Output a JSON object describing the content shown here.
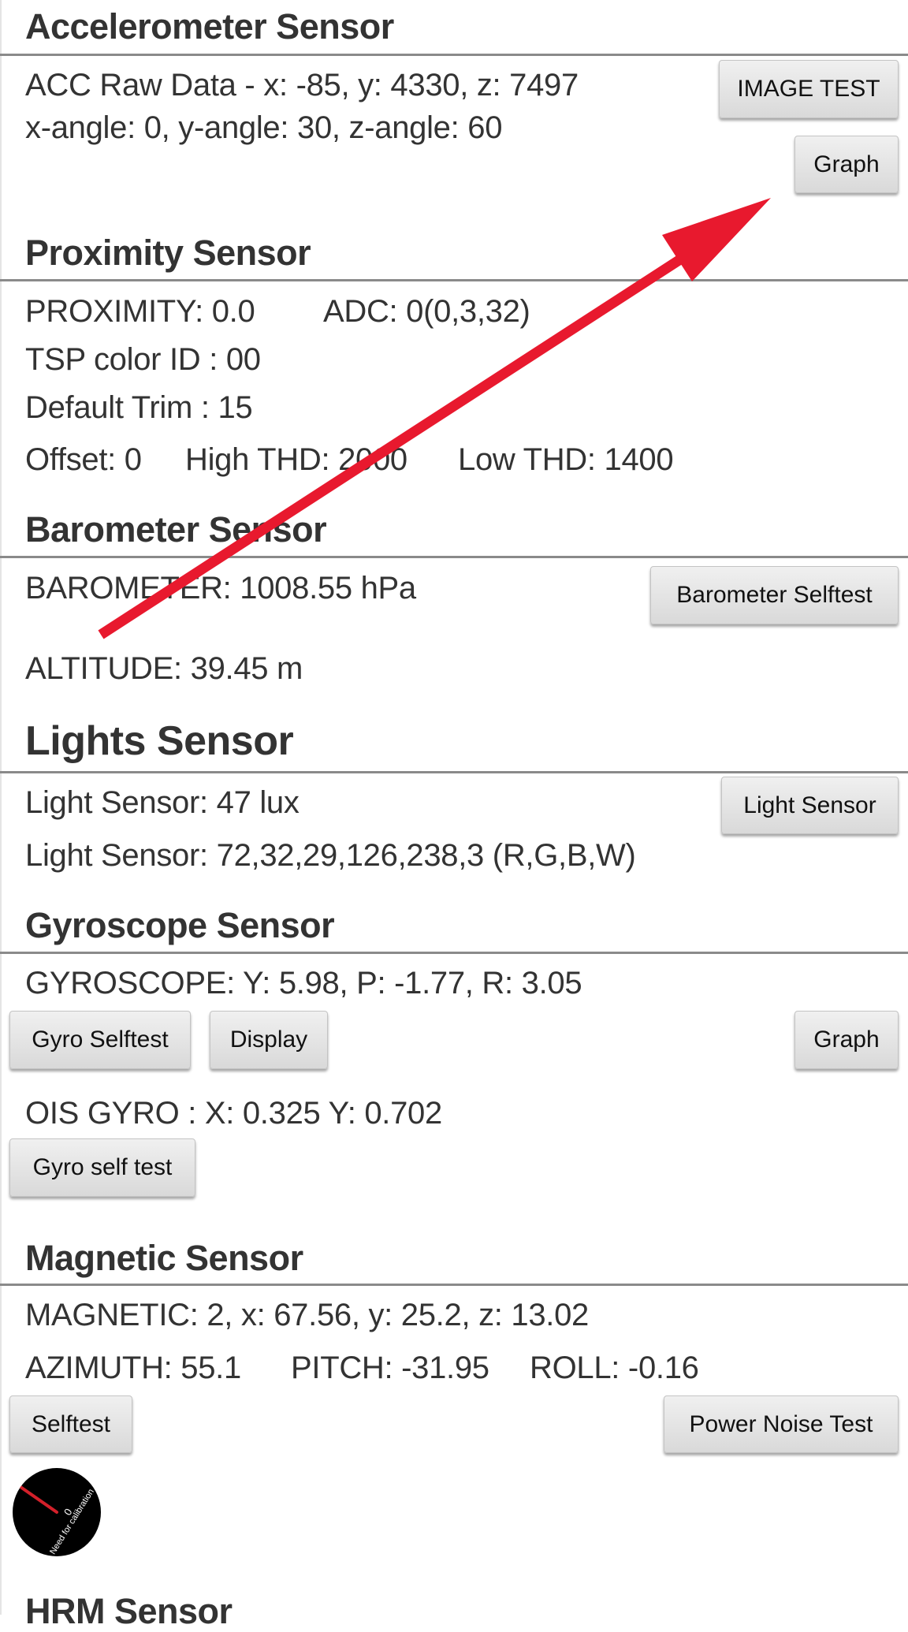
{
  "accelerometer": {
    "title": "Accelerometer Sensor",
    "raw": "ACC Raw Data - x: -85, y: 4330, z: 7497",
    "angles": "x-angle: 0, y-angle: 30, z-angle: 60",
    "image_test_label": "IMAGE TEST",
    "graph_label": "Graph"
  },
  "proximity": {
    "title": "Proximity Sensor",
    "proximity": "PROXIMITY: 0.0",
    "adc": "ADC: 0(0,3,32)",
    "tsp_color": "TSP color ID : 00",
    "default_trim": "Default Trim : 15",
    "offset": "Offset: 0",
    "high_thd": "High THD: 2000",
    "low_thd": "Low THD: 1400"
  },
  "barometer": {
    "title": "Barometer Sensor",
    "pressure": "BAROMETER: 1008.55 hPa",
    "altitude": "ALTITUDE: 39.45 m",
    "selftest_label": "Barometer Selftest"
  },
  "lights": {
    "title": "Lights Sensor",
    "lux": "Light Sensor: 47 lux",
    "rgbw": "Light Sensor: 72,32,29,126,238,3 (R,G,B,W)",
    "button_label": "Light Sensor"
  },
  "gyroscope": {
    "title": "Gyroscope Sensor",
    "values": "GYROSCOPE: Y: 5.98, P: -1.77, R: 3.05",
    "selftest_label": "Gyro Selftest",
    "display_label": "Display",
    "graph_label": "Graph",
    "ois": "OIS GYRO : X: 0.325 Y: 0.702",
    "ois_selftest_label": "Gyro self test"
  },
  "magnetic": {
    "title": "Magnetic Sensor",
    "values": "MAGNETIC: 2, x: 67.56, y: 25.2, z: 13.02",
    "azimuth": "AZIMUTH: 55.1",
    "pitch": "PITCH: -31.95",
    "roll": "ROLL: -0.16",
    "selftest_label": "Selftest",
    "power_noise_label": "Power Noise Test",
    "dial_text": "Need for calibration",
    "dial_value": "0",
    "needle_color": "#d3202a"
  },
  "hrm": {
    "title": "HRM Sensor"
  },
  "annotation": {
    "arrow_color": "#e8192e"
  }
}
